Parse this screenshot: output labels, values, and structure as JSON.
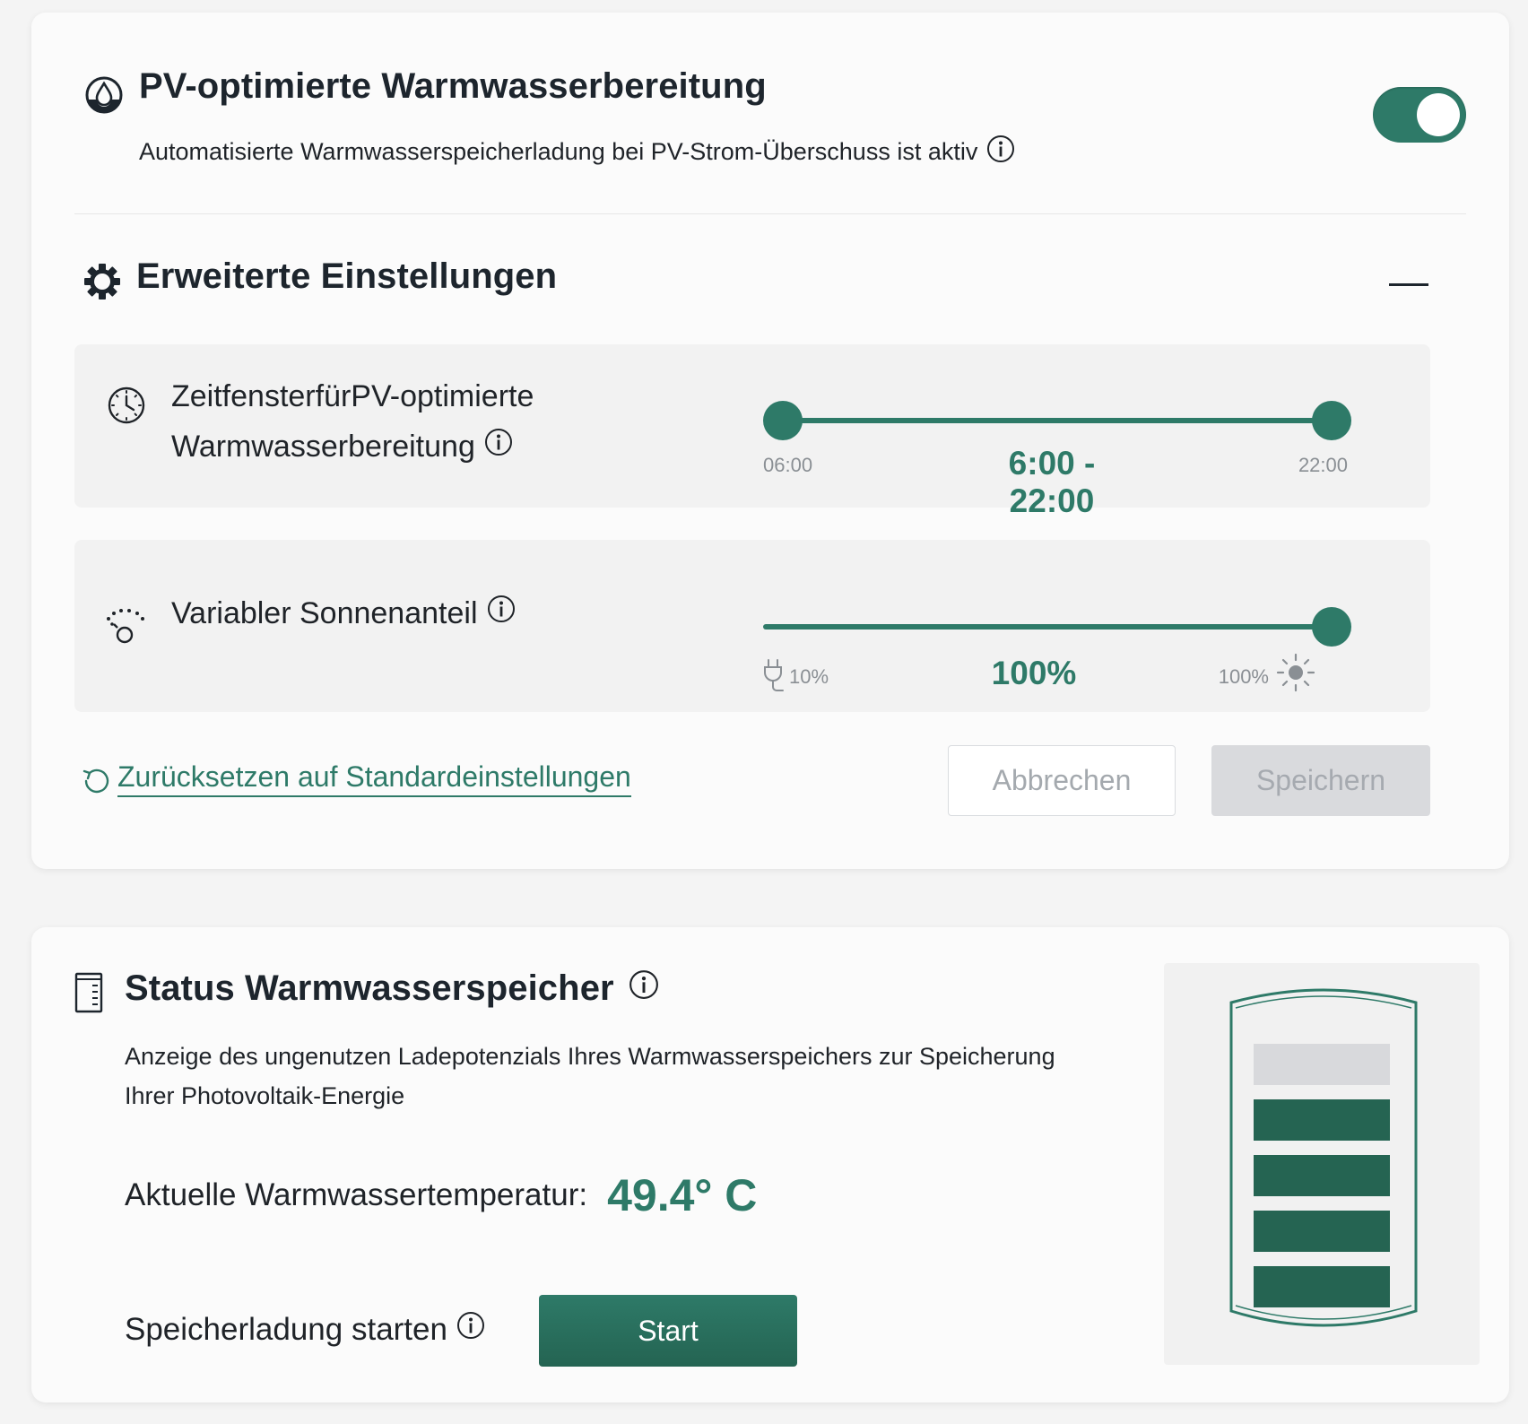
{
  "pv_section": {
    "title": "PV-optimierte Warmwasserbereitung",
    "description": "Automatisierte Warmwasserspeicherladung bei PV-Strom-Überschuss ist aktiv",
    "toggle_on": true,
    "icon": "water-drop-icon"
  },
  "advanced": {
    "title": "Erweiterte Einstellungen",
    "collapse_symbol": "—",
    "icon": "gear-icon",
    "time_window": {
      "label_line1": "ZeitfensterfürPV-optimierte",
      "label_line2": "Warmwasserbereitung",
      "min_label": "06:00",
      "max_label": "22:00",
      "value_label": "6:00 - 22:00",
      "start": "06:00",
      "end": "22:00",
      "range_start": "06:00",
      "range_end": "22:00",
      "icon": "clock-icon"
    },
    "sun_share": {
      "label": "Variabler Sonnenanteil",
      "min_label": "10%",
      "max_label": "100%",
      "value_label": "100%",
      "value": 100,
      "min": 10,
      "max": 100,
      "icon": "sun-share-icon"
    },
    "reset_label": "Zurücksetzen auf Standardeinstellungen",
    "cancel_label": "Abbrechen",
    "save_label": "Speichern"
  },
  "status": {
    "title": "Status Warmwasserspeicher",
    "description_line1": "Anzeige des ungenutzen Ladepotenzials Ihres Warmwasserspeichers zur Speicherung",
    "description_line2": "Ihrer Photovoltaik-Energie",
    "temp_label": "Aktuelle Warmwassertemperatur:",
    "temp_value": "49.4° C",
    "charge_label": "Speicherladung starten",
    "start_label": "Start",
    "tank_levels_filled": 4,
    "tank_levels_total": 5
  },
  "colors": {
    "accent": "#2e7a68",
    "tank_fill": "#256452",
    "tank_empty": "#d8d9dc"
  }
}
